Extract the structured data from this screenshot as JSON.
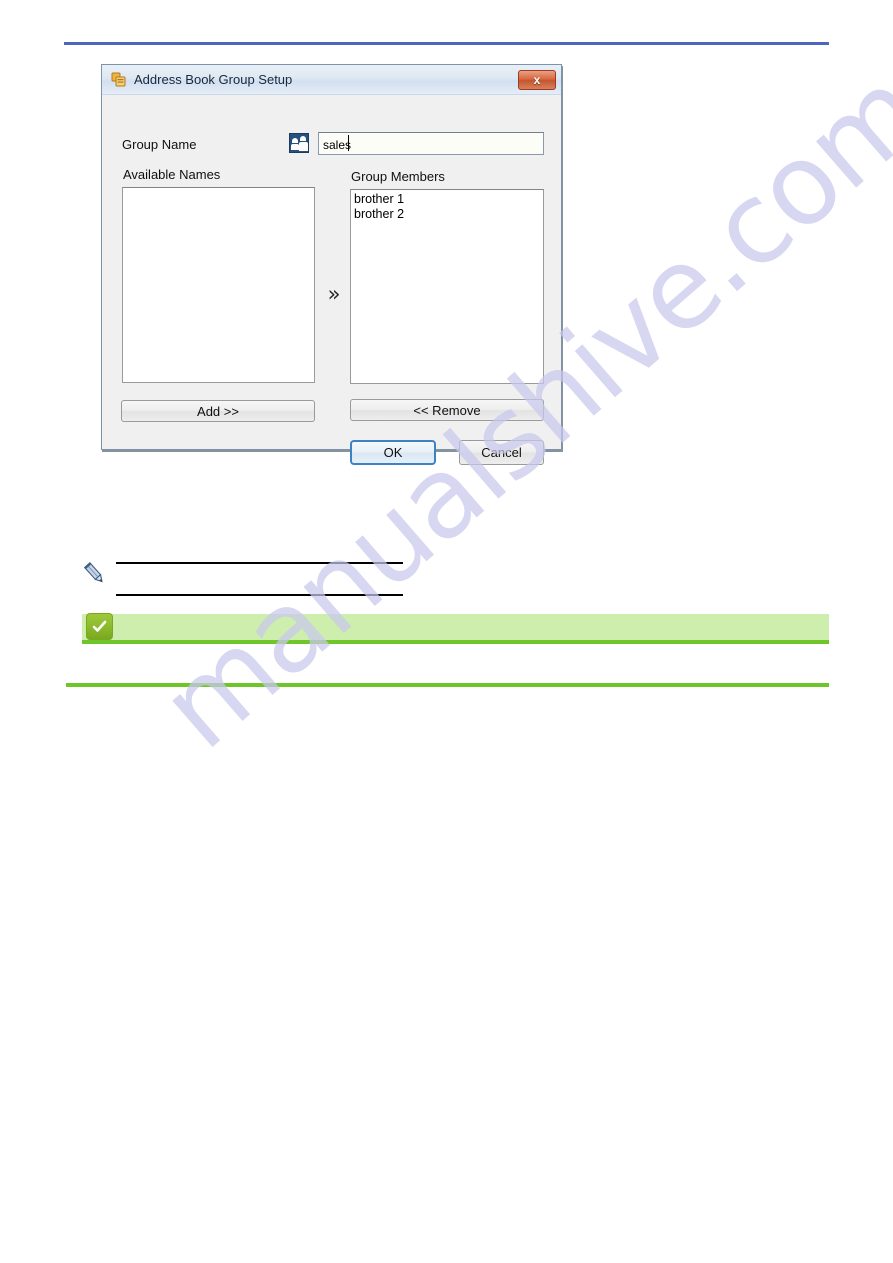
{
  "page": {
    "watermark_text": "manualshive.com",
    "top_rule_color": "#4f66c0",
    "accent_green": "#6fc62b",
    "band_green": "#cdeeac"
  },
  "dialog": {
    "title": "Address Book Group Setup",
    "title_icon": "address-book-icon",
    "close_label": "x",
    "group_name_label": "Group Name",
    "group_icon": "group-contacts-icon",
    "group_name_value": "sales",
    "group_name_placeholder": "",
    "available_names_label": "Available Names",
    "group_members_label": "Group Members",
    "available_names": [],
    "group_members": [
      "brother 1",
      "brother 2"
    ],
    "transfer_glyph": "»",
    "add_label": "Add >>",
    "remove_label": "<< Remove",
    "ok_label": "OK",
    "cancel_label": "Cancel"
  },
  "note": {
    "icon": "pencil-icon",
    "text": ""
  },
  "tip": {
    "icon": "green-check-icon",
    "text": ""
  }
}
